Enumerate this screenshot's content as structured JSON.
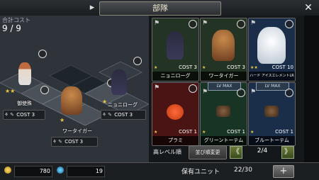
{
  "header": {
    "title": "部隊",
    "back_icon": "▸",
    "close_icon": "✕"
  },
  "formation": {
    "cost_label": "合計コスト",
    "cost_value": "9 / 9",
    "units": [
      {
        "name": "御使殊",
        "stars": "★★",
        "cost_label": "COST",
        "cost": "3"
      },
      {
        "name": "ワータイガー",
        "stars": "★",
        "cost_label": "COST",
        "cost": "3"
      },
      {
        "name": "ニョニローグ",
        "stars": "★",
        "cost_label": "COST",
        "cost": "3"
      }
    ]
  },
  "roster": {
    "cards": [
      {
        "name": "ニョニローグ",
        "cost_label": "COST",
        "cost": "3",
        "stars": "★",
        "color": "#2a3e2a"
      },
      {
        "name": "ワータイガー",
        "cost_label": "COST",
        "cost": "3",
        "stars": "★",
        "color": "#2a3e2a"
      },
      {
        "name": "ハード アイスエレメントLR",
        "cost_label": "COST",
        "cost": "10",
        "stars": "★★",
        "color": "#1e3352"
      },
      {
        "name": "プラミ",
        "cost_label": "COST",
        "cost": "1",
        "stars": "★",
        "color": "#5a1818",
        "banner": ""
      },
      {
        "name": "グリーントーテム",
        "cost_label": "COST",
        "cost": "1",
        "stars": "★",
        "color": "#1e3a28",
        "banner": "LV MAX"
      },
      {
        "name": "ブルートーテム",
        "cost_label": "COST",
        "cost": "1",
        "stars": "★",
        "color": "#1e3352",
        "banner": "LV MAX"
      }
    ],
    "sort_label": "高レベル順",
    "sort_change_label": "並び順変更",
    "page": "2/4",
    "prev_icon": "《",
    "next_icon": "》"
  },
  "footer": {
    "gold": "780",
    "gems": "19",
    "owned_label": "保有ユニット",
    "owned_value": "22/30",
    "plus_label": "+"
  }
}
